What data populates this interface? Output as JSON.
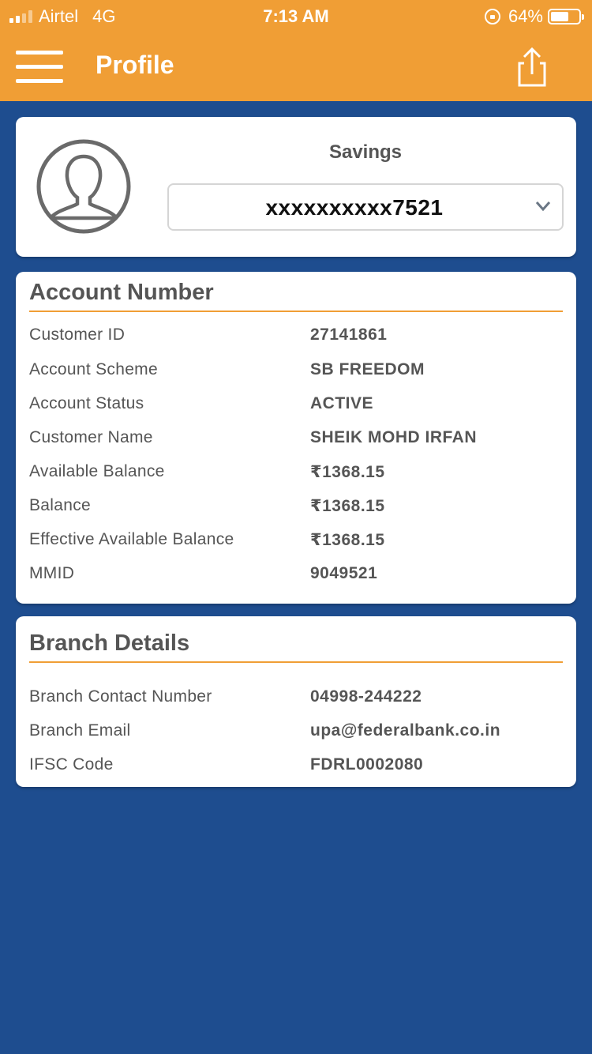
{
  "status_bar": {
    "carrier": "Airtel",
    "network": "4G",
    "time": "7:13 AM",
    "battery": "64%",
    "battery_level": 0.64
  },
  "header": {
    "title": "Profile",
    "menu_icon": "hamburger-icon",
    "share_icon": "share-icon"
  },
  "profile": {
    "avatar_icon": "user-avatar-icon",
    "account_type": "Savings",
    "account_number": "xxxxxxxxxx7521",
    "dropdown_icon": "chevron-down-icon"
  },
  "account_section": {
    "title": "Account Number",
    "rows": [
      {
        "label": "Customer ID",
        "value": "27141861"
      },
      {
        "label": "Account Scheme",
        "value": "SB FREEDOM"
      },
      {
        "label": "Account Status",
        "value": "ACTIVE"
      },
      {
        "label": "Customer Name",
        "value": "SHEIK MOHD IRFAN"
      },
      {
        "label": "Available Balance",
        "value": "₹1368.15"
      },
      {
        "label": "Balance",
        "value": "₹1368.15"
      },
      {
        "label": "Effective Available Balance",
        "value": "₹1368.15"
      },
      {
        "label": "MMID",
        "value": "9049521"
      }
    ]
  },
  "branch_section": {
    "title": "Branch Details",
    "rows": [
      {
        "label": "Branch Contact Number",
        "value": "04998-244222"
      },
      {
        "label": "Branch Email",
        "value": "upa@federalbank.co.in"
      },
      {
        "label": "IFSC Code",
        "value": "FDRL0002080"
      }
    ]
  },
  "colors": {
    "header_orange": "#f09e35",
    "background_blue": "#1e4d8f",
    "card_white": "#ffffff",
    "text_gray": "#555555"
  }
}
